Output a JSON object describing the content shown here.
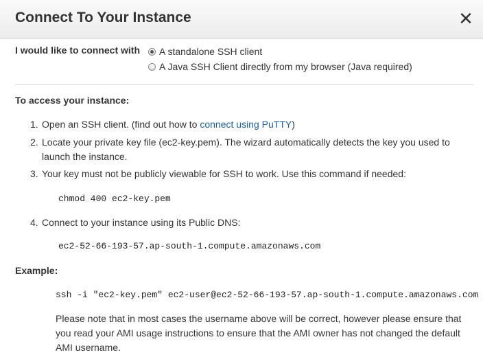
{
  "dialog": {
    "title": "Connect To Your Instance",
    "close_glyph": "✕"
  },
  "connect_with": {
    "label": "I would like to connect with",
    "options": [
      {
        "label": "A standalone SSH client",
        "selected": true
      },
      {
        "label": "A Java SSH Client directly from my browser (Java required)",
        "selected": false
      }
    ]
  },
  "access": {
    "heading": "To access your instance:",
    "steps": [
      {
        "num": "1.",
        "before": "Open an SSH client. (find out how to ",
        "link": "connect using PuTTY",
        "after": ")"
      },
      {
        "num": "2.",
        "text": "Locate your private key file (ec2-key.pem). The wizard automatically detects the key you used to launch the instance."
      },
      {
        "num": "3.",
        "text": "Your key must not be publicly viewable for SSH to work. Use this command if needed:"
      },
      {
        "num": "4.",
        "text": "Connect to your instance using its Public DNS:"
      }
    ],
    "chmod_command": "chmod 400 ec2-key.pem",
    "public_dns": "ec2-52-66-193-57.ap-south-1.compute.amazonaws.com"
  },
  "example": {
    "heading": "Example:",
    "command": "ssh -i \"ec2-key.pem\" ec2-user@ec2-52-66-193-57.ap-south-1.compute.amazonaws.com",
    "note": "Please note that in most cases the username above will be correct, however please ensure that you read your AMI usage instructions to ensure that the AMI owner has not changed the default AMI username."
  }
}
